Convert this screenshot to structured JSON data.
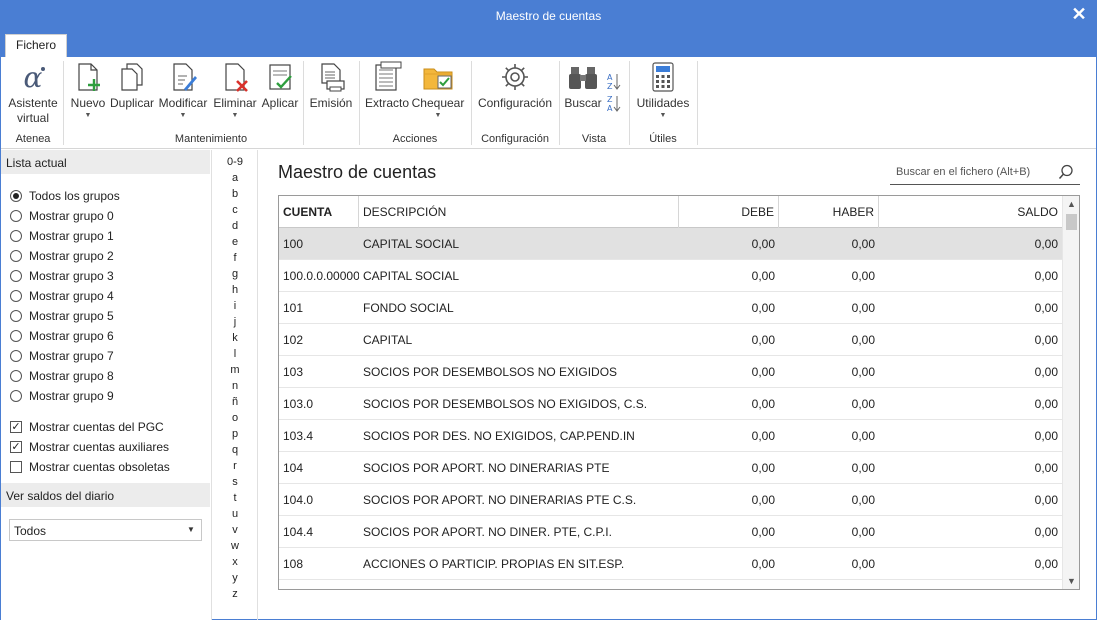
{
  "window": {
    "title": "Maestro de cuentas",
    "close_glyph": "✕"
  },
  "tabs": {
    "fichero": "Fichero"
  },
  "ribbon": {
    "asistente": "Asistente virtual",
    "asistente_l1": "Asistente",
    "asistente_l2": "virtual",
    "nuevo": "Nuevo",
    "duplicar": "Duplicar",
    "modificar": "Modificar",
    "eliminar": "Eliminar",
    "aplicar": "Aplicar",
    "emision": "Emisión",
    "extracto": "Extracto",
    "chequear": "Chequear",
    "configuracion": "Configuración",
    "buscar": "Buscar",
    "utilidades": "Utilidades",
    "groups": {
      "atenea": "Atenea",
      "mantenimiento": "Mantenimiento",
      "acciones": "Acciones",
      "configuracion": "Configuración",
      "vista": "Vista",
      "utiles": "Útiles"
    }
  },
  "left": {
    "lista_actual": "Lista actual",
    "radios": [
      {
        "label": "Todos los grupos",
        "checked": true
      },
      {
        "label": "Mostrar grupo 0",
        "checked": false
      },
      {
        "label": "Mostrar grupo 1",
        "checked": false
      },
      {
        "label": "Mostrar grupo 2",
        "checked": false
      },
      {
        "label": "Mostrar grupo 3",
        "checked": false
      },
      {
        "label": "Mostrar grupo 4",
        "checked": false
      },
      {
        "label": "Mostrar grupo 5",
        "checked": false
      },
      {
        "label": "Mostrar grupo 6",
        "checked": false
      },
      {
        "label": "Mostrar grupo 7",
        "checked": false
      },
      {
        "label": "Mostrar grupo 8",
        "checked": false
      },
      {
        "label": "Mostrar grupo 9",
        "checked": false
      }
    ],
    "checks": [
      {
        "label": "Mostrar cuentas del PGC",
        "checked": true
      },
      {
        "label": "Mostrar cuentas auxiliares",
        "checked": true
      },
      {
        "label": "Mostrar cuentas obsoletas",
        "checked": false
      }
    ],
    "ver_saldos": "Ver saldos del diario",
    "saldos_value": "Todos"
  },
  "alphabet": [
    "0-9",
    "a",
    "b",
    "c",
    "d",
    "e",
    "f",
    "g",
    "h",
    "i",
    "j",
    "k",
    "l",
    "m",
    "n",
    "ñ",
    "o",
    "p",
    "q",
    "r",
    "s",
    "t",
    "u",
    "v",
    "w",
    "x",
    "y",
    "z"
  ],
  "main": {
    "title": "Maestro de cuentas",
    "search_placeholder": "Buscar en el fichero (Alt+B)",
    "columns": {
      "cuenta": "CUENTA",
      "descripcion": "DESCRIPCIÓN",
      "debe": "DEBE",
      "haber": "HABER",
      "saldo": "SALDO"
    },
    "rows": [
      {
        "cuenta": "100",
        "descripcion": "CAPITAL SOCIAL",
        "debe": "0,00",
        "haber": "0,00",
        "saldo": "0,00"
      },
      {
        "cuenta": "100.0.0.00000",
        "descripcion": "CAPITAL SOCIAL",
        "debe": "0,00",
        "haber": "0,00",
        "saldo": "0,00"
      },
      {
        "cuenta": "101",
        "descripcion": "FONDO SOCIAL",
        "debe": "0,00",
        "haber": "0,00",
        "saldo": "0,00"
      },
      {
        "cuenta": "102",
        "descripcion": "CAPITAL",
        "debe": "0,00",
        "haber": "0,00",
        "saldo": "0,00"
      },
      {
        "cuenta": "103",
        "descripcion": "SOCIOS POR DESEMBOLSOS NO EXIGIDOS",
        "debe": "0,00",
        "haber": "0,00",
        "saldo": "0,00"
      },
      {
        "cuenta": "103.0",
        "descripcion": "SOCIOS POR DESEMBOLSOS NO EXIGIDOS, C.S.",
        "debe": "0,00",
        "haber": "0,00",
        "saldo": "0,00"
      },
      {
        "cuenta": "103.4",
        "descripcion": "SOCIOS POR DES. NO EXIGIDOS, CAP.PEND.IN",
        "debe": "0,00",
        "haber": "0,00",
        "saldo": "0,00"
      },
      {
        "cuenta": "104",
        "descripcion": "SOCIOS POR APORT. NO DINERARIAS PTE",
        "debe": "0,00",
        "haber": "0,00",
        "saldo": "0,00"
      },
      {
        "cuenta": "104.0",
        "descripcion": "SOCIOS POR APORT. NO DINERARIAS PTE C.S.",
        "debe": "0,00",
        "haber": "0,00",
        "saldo": "0,00"
      },
      {
        "cuenta": "104.4",
        "descripcion": "SOCIOS POR APORT. NO DINER. PTE, C.P.I.",
        "debe": "0,00",
        "haber": "0,00",
        "saldo": "0,00"
      },
      {
        "cuenta": "108",
        "descripcion": "ACCIONES O PARTICIP. PROPIAS EN SIT.ESP.",
        "debe": "0,00",
        "haber": "0,00",
        "saldo": "0,00"
      }
    ],
    "selected_row": 0
  },
  "colors": {
    "titlebar": "#4a7ed3",
    "selected_row": "#e1e1e1",
    "accent_green": "#2e9e3e",
    "accent_red": "#d9312b"
  }
}
